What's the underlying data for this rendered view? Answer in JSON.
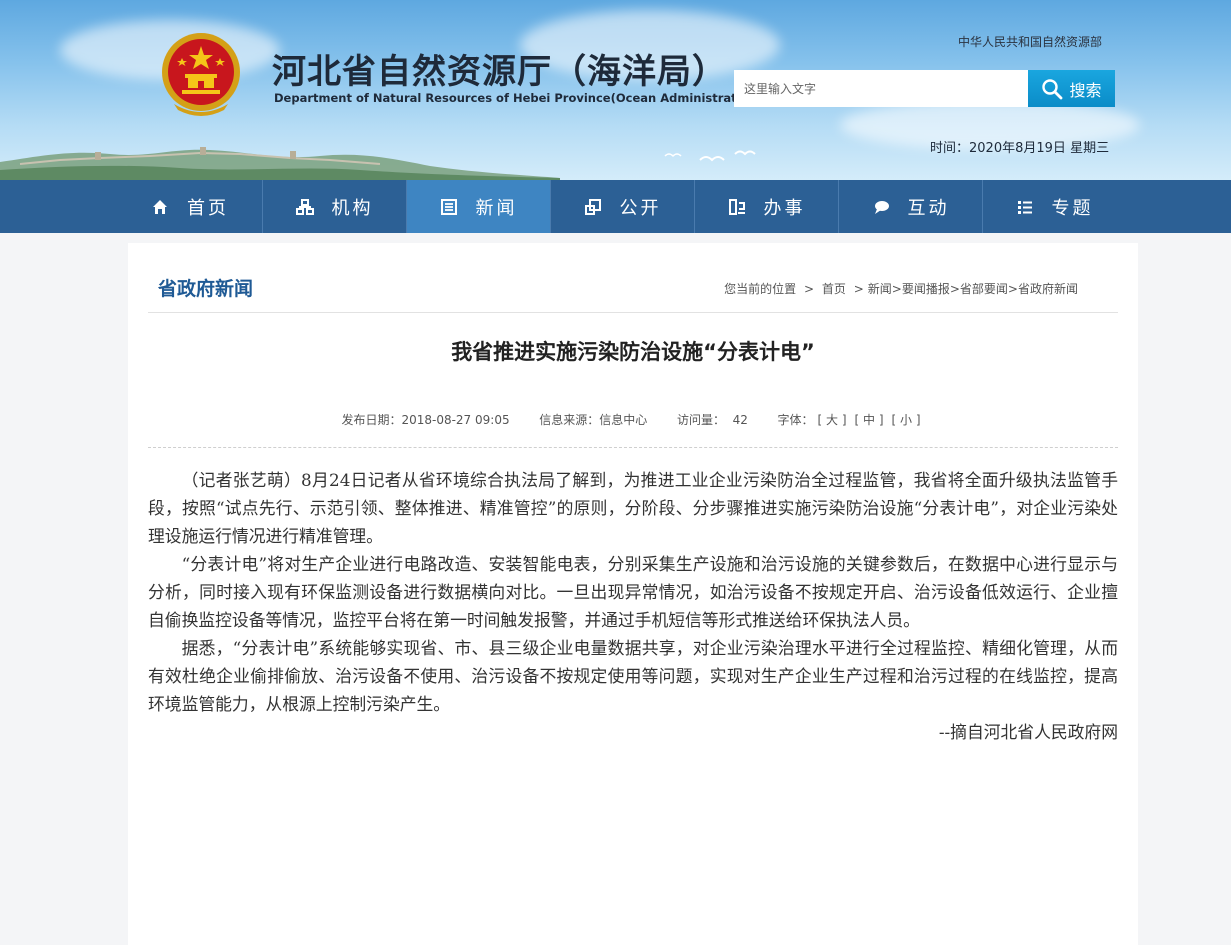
{
  "header": {
    "site_title": "河北省自然资源厅（海洋局）",
    "site_subtitle": "Department of Natural Resources of Hebei Province(Ocean  Administration)",
    "ministry_link": "中华人民共和国自然资源部",
    "search_placeholder": "这里输入文字",
    "search_button": "搜索",
    "date_label": "时间：",
    "date_value": "2020年8月19日",
    "weekday": "星期三"
  },
  "nav": {
    "items": [
      {
        "label": "首页",
        "icon": "home-icon"
      },
      {
        "label": "机构",
        "icon": "org-icon"
      },
      {
        "label": "新闻",
        "icon": "news-icon",
        "active": true
      },
      {
        "label": "公开",
        "icon": "disclosure-icon"
      },
      {
        "label": "办事",
        "icon": "service-icon"
      },
      {
        "label": "互动",
        "icon": "chat-icon"
      },
      {
        "label": "专题",
        "icon": "list-icon"
      }
    ]
  },
  "section": {
    "title": "省政府新闻",
    "breadcrumb": [
      "您当前的位置",
      "首页",
      "新闻",
      "要闻播报",
      "省部要闻",
      "省政府新闻"
    ]
  },
  "article": {
    "title": "我省推进实施污染防治设施“分表计电”",
    "publish_label": "发布日期：",
    "publish_date": "2018-08-27 09:05",
    "source_label": "信息来源：",
    "source_value": "信息中心",
    "views_label": "访问量：",
    "views_value": "42",
    "font_label": "字体：",
    "font_large": "[ 大 ]",
    "font_medium": "[ 中 ]",
    "font_small": "[ 小 ]",
    "paragraphs": [
      "（记者张艺萌）8月24日记者从省环境综合执法局了解到，为推进工业企业污染防治全过程监管，我省将全面升级执法监管手段，按照“试点先行、示范引领、整体推进、精准管控”的原则，分阶段、分步骤推进实施污染防治设施“分表计电”，对企业污染处理设施运行情况进行精准管理。",
      "“分表计电”将对生产企业进行电路改造、安装智能电表，分别采集生产设施和治污设施的关键参数后，在数据中心进行显示与分析，同时接入现有环保监测设备进行数据横向对比。一旦出现异常情况，如治污设备不按规定开启、治污设备低效运行、企业擅自偷换监控设备等情况，监控平台将在第一时间触发报警，并通过手机短信等形式推送给环保执法人员。",
      "据悉，“分表计电”系统能够实现省、市、县三级企业电量数据共享，对企业污染治理水平进行全过程监控、精细化管理，从而有效杜绝企业偷排偷放、治污设备不使用、治污设备不按规定使用等问题，实现对生产企业生产过程和治污过程的在线监控，提高环境监管能力，从根源上控制污染产生。"
    ],
    "source_note": "--摘自河北省人民政府网"
  }
}
